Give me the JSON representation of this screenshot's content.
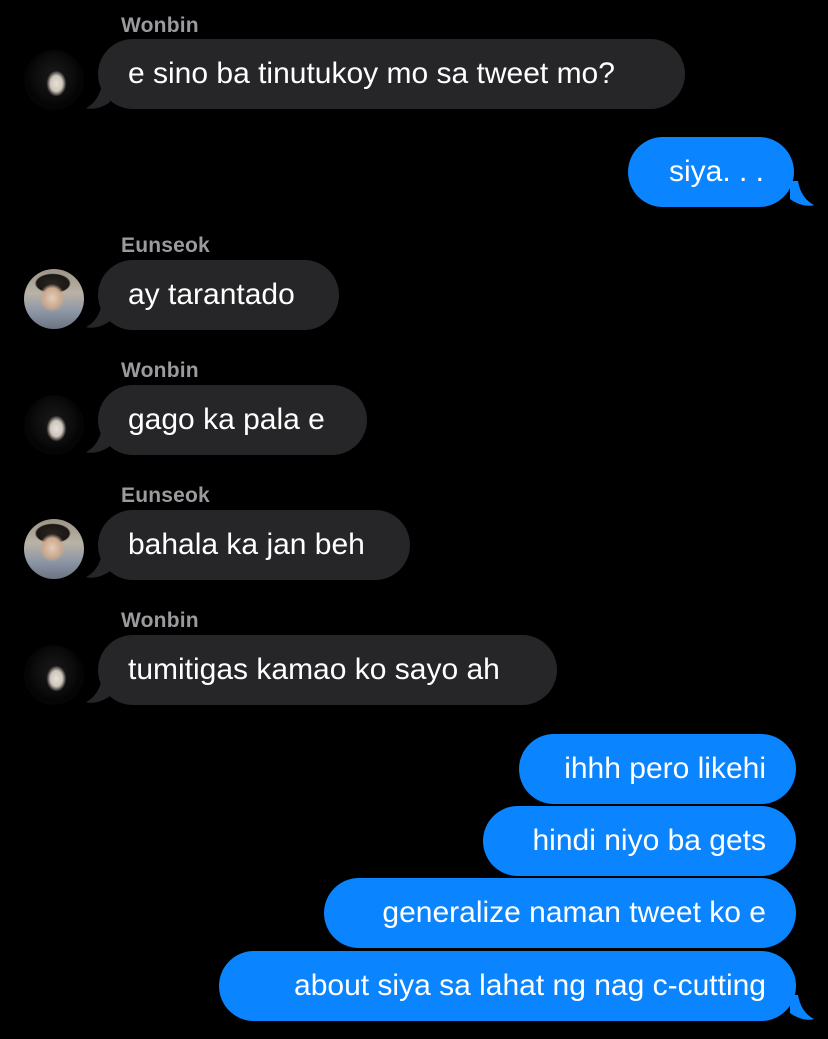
{
  "conversation": {
    "blocks": [
      {
        "sender": "Wonbin",
        "avatar": "wonbin-avatar",
        "messages": [
          "e sino ba tinutukoy mo sa tweet mo?"
        ]
      },
      {
        "sender": "",
        "outgoing": true,
        "messages": [
          "siya. . ."
        ]
      },
      {
        "sender": "Eunseok",
        "avatar": "eunseok-avatar",
        "messages": [
          "ay tarantado"
        ]
      },
      {
        "sender": "Wonbin",
        "avatar": "wonbin-avatar",
        "messages": [
          "gago ka pala e"
        ]
      },
      {
        "sender": "Eunseok",
        "avatar": "eunseok-avatar",
        "messages": [
          "bahala ka jan beh"
        ]
      },
      {
        "sender": "Wonbin",
        "avatar": "wonbin-avatar",
        "messages": [
          "tumitigas kamao ko sayo ah"
        ]
      },
      {
        "sender": "",
        "outgoing": true,
        "messages": [
          "ihhh pero likehi",
          "hindi niyo ba gets",
          "generalize naman tweet ko e",
          "about siya sa lahat ng nag c-cutting"
        ]
      }
    ]
  },
  "colors": {
    "background": "#000000",
    "incoming_bubble": "#262628",
    "outgoing_bubble": "#0a84ff",
    "sender_name": "#9a9a9f",
    "text": "#ffffff"
  }
}
